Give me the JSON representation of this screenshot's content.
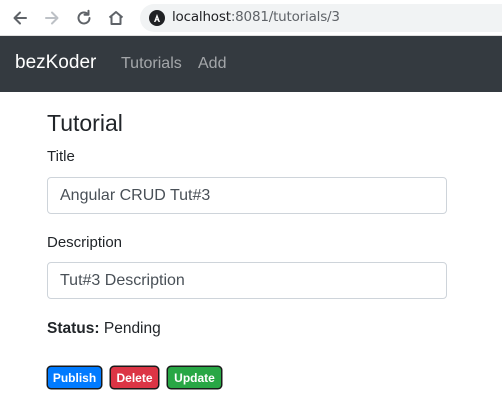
{
  "browser": {
    "url_host": "localhost",
    "url_rest": ":8081/tutorials/3",
    "icons": [
      "back-arrow-icon",
      "forward-arrow-icon",
      "reload-icon",
      "home-icon",
      "angular-site-icon"
    ]
  },
  "navbar": {
    "brand": "bezKoder",
    "links": [
      {
        "label": "Tutorials"
      },
      {
        "label": "Add"
      }
    ]
  },
  "form": {
    "heading": "Tutorial",
    "title_label": "Title",
    "title_value": "Angular CRUD Tut#3",
    "description_label": "Description",
    "description_value": "Tut#3 Description",
    "status_label": "Status:",
    "status_value": "Pending"
  },
  "actions": {
    "publish": "Publish",
    "delete": "Delete",
    "update": "Update"
  },
  "colors": {
    "navbar_bg": "#343a40",
    "publish": "#007bff",
    "delete": "#dc3545",
    "update": "#28a745"
  }
}
